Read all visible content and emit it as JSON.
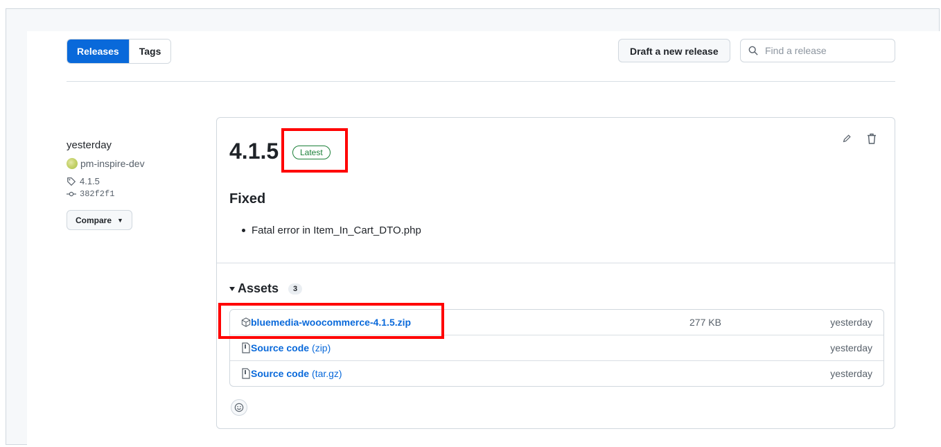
{
  "header": {
    "tabs": [
      {
        "label": "Releases",
        "active": true
      },
      {
        "label": "Tags",
        "active": false
      }
    ],
    "draft_button": "Draft a new release",
    "search_placeholder": "Find a release"
  },
  "release_meta": {
    "date": "yesterday",
    "author": "pm-inspire-dev",
    "tag": "4.1.5",
    "commit": "382f2f1",
    "compare_label": "Compare"
  },
  "release": {
    "title": "4.1.5",
    "badge": "Latest",
    "section_heading": "Fixed",
    "notes": [
      "Fatal error in Item_In_Cart_DTO.php"
    ],
    "assets_heading": "Assets",
    "assets_count": "3",
    "assets": [
      {
        "name": "bluemedia-woocommerce-4.1.5.zip",
        "suffix": "",
        "size": "277 KB",
        "date": "yesterday"
      },
      {
        "name": "Source code",
        "suffix": "(zip)",
        "size": "",
        "date": "yesterday"
      },
      {
        "name": "Source code",
        "suffix": "(tar.gz)",
        "size": "",
        "date": "yesterday"
      }
    ]
  },
  "colors": {
    "accent": "#0969da",
    "latest": "#1a7f37",
    "highlight": "#ff0000"
  }
}
